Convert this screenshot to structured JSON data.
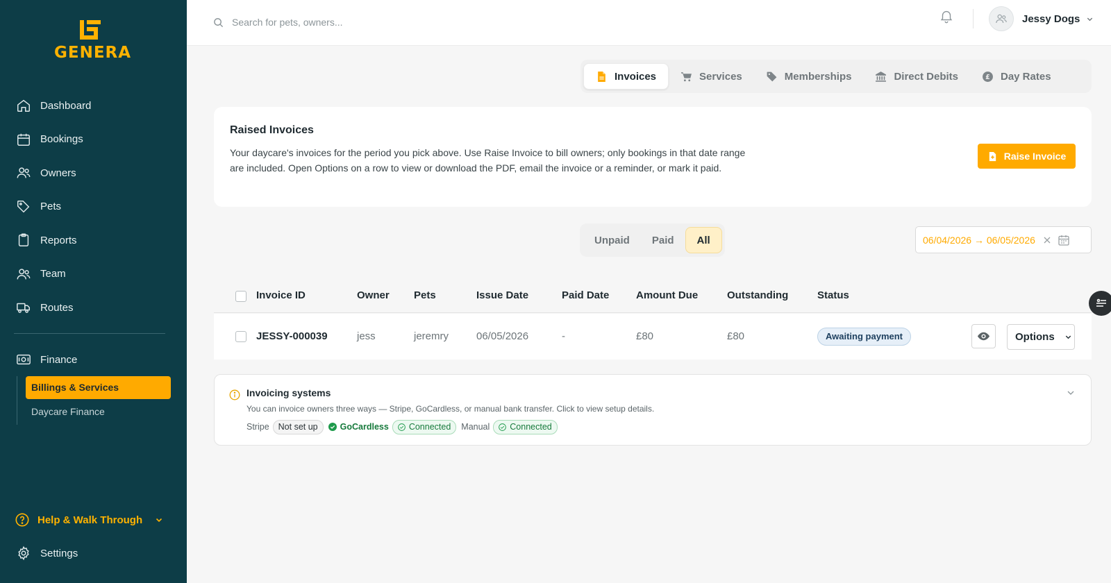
{
  "brand": {
    "name": "GENERA",
    "accent": "#ffaa00",
    "sidebar_bg": "#0d3d47"
  },
  "sidebar": {
    "items": [
      {
        "label": "Dashboard",
        "icon": "home-icon"
      },
      {
        "label": "Bookings",
        "icon": "calendar-icon"
      },
      {
        "label": "Owners",
        "icon": "users-icon"
      },
      {
        "label": "Pets",
        "icon": "tag-icon"
      },
      {
        "label": "Reports",
        "icon": "clipboard-icon"
      },
      {
        "label": "Team",
        "icon": "team-icon"
      },
      {
        "label": "Routes",
        "icon": "truck-icon"
      }
    ],
    "finance": {
      "label": "Finance",
      "icon": "money-icon"
    },
    "finance_sub": [
      {
        "label": "Billings & Services",
        "active": true
      },
      {
        "label": "Daycare Finance",
        "active": false
      }
    ],
    "help": "Help & Walk Through",
    "settings": "Settings"
  },
  "topbar": {
    "search_placeholder": "Search for pets, owners...",
    "user_name": "Jessy Dogs"
  },
  "tabs": [
    {
      "label": "Invoices",
      "icon": "document-icon",
      "active": true
    },
    {
      "label": "Services",
      "icon": "cart-icon",
      "active": false
    },
    {
      "label": "Memberships",
      "icon": "tag-icon",
      "active": false
    },
    {
      "label": "Direct Debits",
      "icon": "bank-icon",
      "active": false
    },
    {
      "label": "Day Rates",
      "icon": "pound-coin-icon",
      "active": false
    }
  ],
  "card": {
    "title": "Raised Invoices",
    "description": "Your daycare's invoices for the period you pick above. Use Raise Invoice to bill owners; only bookings in that date range are included. Open Options on a row to view or download the PDF, email the invoice or a reminder, or mark it paid.",
    "raise_button": "Raise Invoice"
  },
  "filters": {
    "options": [
      "Unpaid",
      "Paid",
      "All"
    ],
    "selected": "All",
    "date_range": "06/04/2026 → 06/05/2026"
  },
  "table": {
    "columns": [
      "Invoice ID",
      "Owner",
      "Pets",
      "Issue Date",
      "Paid Date",
      "Amount Due",
      "Outstanding",
      "Status"
    ],
    "rows": [
      {
        "invoice_id": "JESSY-000039",
        "owner": "jess",
        "pets": "jeremry",
        "issue_date": "06/05/2026",
        "paid_date": "-",
        "amount_due": "£80",
        "outstanding": "£80",
        "status": "Awaiting payment",
        "options_label": "Options"
      }
    ]
  },
  "invoicing_systems": {
    "title": "Invoicing systems",
    "description": "You can invoice owners three ways — Stripe, GoCardless, or manual bank transfer. Click to view setup details.",
    "stripe_label": "Stripe",
    "stripe_status": "Not set up",
    "gocardless_label": "GoCardless",
    "gocardless_status": "Connected",
    "manual_label": "Manual",
    "manual_status": "Connected"
  }
}
